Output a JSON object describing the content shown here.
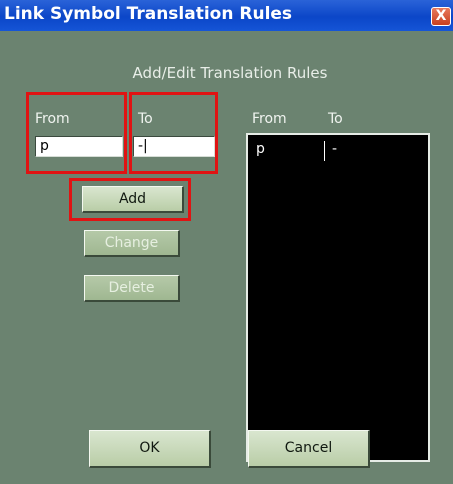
{
  "window": {
    "title": "Link Symbol Translation Rules",
    "close_symbol": "X"
  },
  "dialog": {
    "heading": "Add/Edit Translation Rules",
    "from_label": "From",
    "to_label": "To",
    "from_value": "p",
    "to_value": "-|"
  },
  "list": {
    "columns": [
      "From",
      "To"
    ],
    "rows": [
      {
        "from": "p",
        "to": "-"
      }
    ]
  },
  "buttons": {
    "add": "Add",
    "change": "Change",
    "delete": "Delete",
    "ok": "OK",
    "cancel": "Cancel"
  },
  "colors": {
    "highlight": "#e01313",
    "title_bar": "#0b46c8",
    "panel": "#6b8370"
  }
}
